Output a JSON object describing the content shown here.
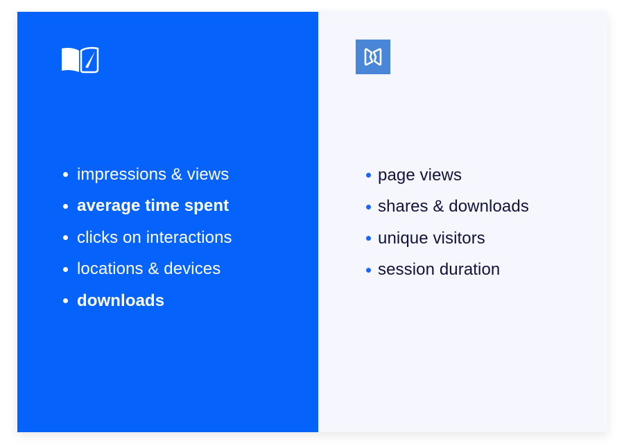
{
  "colors": {
    "left_panel_bg": "#0562fb",
    "right_panel_bg": "#f5f6fe",
    "right_logo_bg": "#4a86d8",
    "right_text": "#12133a",
    "right_bullet": "#1a66f5"
  },
  "left": {
    "logo_icon": "open-book-icon",
    "items": [
      {
        "label": "impressions & views",
        "bold": false
      },
      {
        "label": "average time spent",
        "bold": true
      },
      {
        "label": "clicks on interactions",
        "bold": false
      },
      {
        "label": "locations & devices",
        "bold": false
      },
      {
        "label": "downloads",
        "bold": true
      }
    ]
  },
  "right": {
    "logo_icon": "bowtie-logo-icon",
    "items": [
      {
        "label": "page views"
      },
      {
        "label": "shares & downloads"
      },
      {
        "label": "unique visitors"
      },
      {
        "label": "session duration"
      }
    ]
  }
}
